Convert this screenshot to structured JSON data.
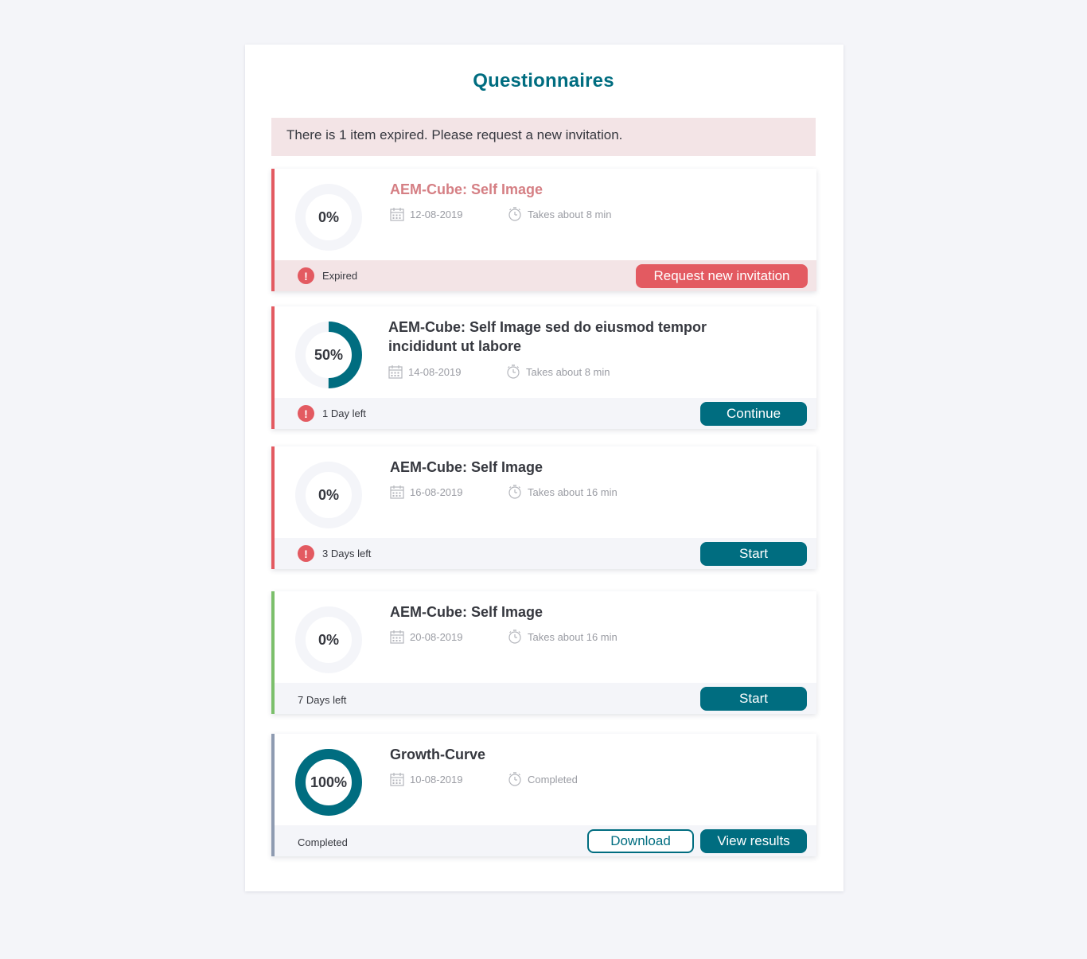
{
  "page": {
    "title": "Questionnaires"
  },
  "alert": {
    "text": "There is 1 item expired. Please request a new invitation."
  },
  "cards": [
    {
      "progress": 0,
      "progress_label": "0%",
      "title": "AEM-Cube: Self Image",
      "date": "12-08-2019",
      "duration": "Takes about 8 min",
      "status": "Expired",
      "buttons": [
        "Request new invitation"
      ]
    },
    {
      "progress": 50,
      "progress_label": "50%",
      "title": "AEM-Cube: Self Image sed do eiusmod tempor incididunt ut labore",
      "date": "14-08-2019",
      "duration": "Takes about 8 min",
      "status": "1 Day left",
      "buttons": [
        "Continue"
      ]
    },
    {
      "progress": 0,
      "progress_label": "0%",
      "title": "AEM-Cube: Self Image",
      "date": "16-08-2019",
      "duration": "Takes about 16 min",
      "status": "3 Days left",
      "buttons": [
        "Start"
      ]
    },
    {
      "progress": 0,
      "progress_label": "0%",
      "title": "AEM-Cube: Self Image",
      "date": "20-08-2019",
      "duration": "Takes about 16 min",
      "status": "7 Days left",
      "buttons": [
        "Start"
      ]
    },
    {
      "progress": 100,
      "progress_label": "100%",
      "title": "Growth-Curve",
      "date": "10-08-2019",
      "duration": "Completed",
      "status": "Completed",
      "buttons": [
        "Download",
        "View results"
      ]
    }
  ],
  "icons": {
    "date": "calendar-icon",
    "duration": "stopwatch-icon",
    "warning": "exclamation-icon"
  },
  "colors": {
    "brand": "#006d80",
    "danger": "#e35a61",
    "success": "#7bbf6b",
    "neutral": "#8e9bb1",
    "ring_track": "#f4f5f9"
  }
}
